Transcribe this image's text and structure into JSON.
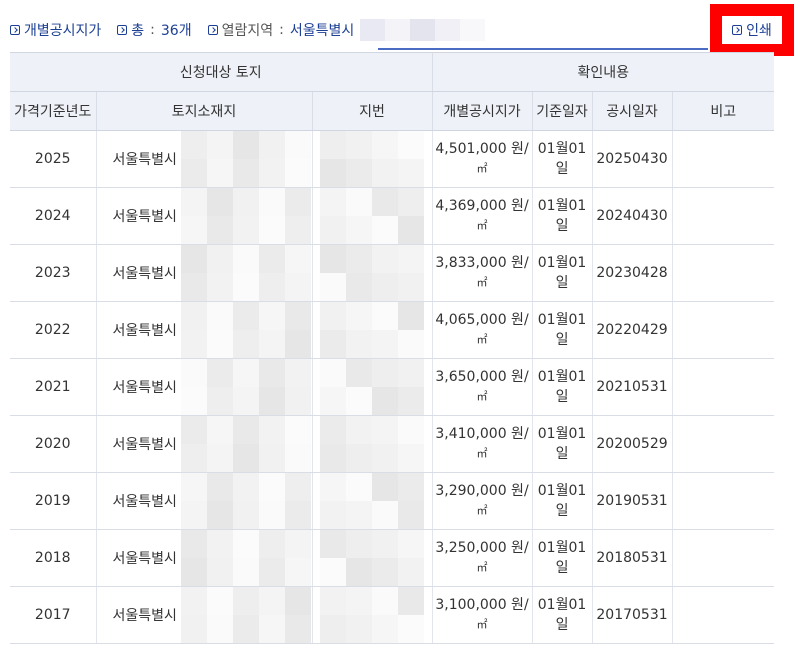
{
  "info": {
    "type_label": "개별공시지가",
    "total_label": "총",
    "total_value": "36개",
    "region_label": "열람지역",
    "region_value": "서울특별시",
    "separator": ":"
  },
  "print": {
    "label": "인쇄"
  },
  "table": {
    "group_headers": {
      "land": "신청대상 토지",
      "confirm": "확인내용"
    },
    "headers": {
      "year": "가격기준년도",
      "address": "토지소재지",
      "jibun": "지번",
      "price": "개별공시지가",
      "base_date": "기준일자",
      "announce_date": "공시일자",
      "note": "비고"
    },
    "rows": [
      {
        "year": "2025",
        "address": "서울특별시",
        "price": "4,501,000 원/",
        "unit": "㎡",
        "base_line1": "01월01",
        "base_line2": "일",
        "announce": "20250430",
        "note": ""
      },
      {
        "year": "2024",
        "address": "서울특별시",
        "price": "4,369,000 원/",
        "unit": "㎡",
        "base_line1": "01월01",
        "base_line2": "일",
        "announce": "20240430",
        "note": ""
      },
      {
        "year": "2023",
        "address": "서울특별시",
        "price": "3,833,000 원/",
        "unit": "㎡",
        "base_line1": "01월01",
        "base_line2": "일",
        "announce": "20230428",
        "note": ""
      },
      {
        "year": "2022",
        "address": "서울특별시",
        "price": "4,065,000 원/",
        "unit": "㎡",
        "base_line1": "01월01",
        "base_line2": "일",
        "announce": "20220429",
        "note": ""
      },
      {
        "year": "2021",
        "address": "서울특별시",
        "price": "3,650,000 원/",
        "unit": "㎡",
        "base_line1": "01월01",
        "base_line2": "일",
        "announce": "20210531",
        "note": ""
      },
      {
        "year": "2020",
        "address": "서울특별시",
        "price": "3,410,000 원/",
        "unit": "㎡",
        "base_line1": "01월01",
        "base_line2": "일",
        "announce": "20200529",
        "note": ""
      },
      {
        "year": "2019",
        "address": "서울특별시",
        "price": "3,290,000 원/",
        "unit": "㎡",
        "base_line1": "01월01",
        "base_line2": "일",
        "announce": "20190531",
        "note": ""
      },
      {
        "year": "2018",
        "address": "서울특별시",
        "price": "3,250,000 원/",
        "unit": "㎡",
        "base_line1": "01월01",
        "base_line2": "일",
        "announce": "20180531",
        "note": ""
      },
      {
        "year": "2017",
        "address": "서울특별시",
        "price": "3,100,000 원/",
        "unit": "㎡",
        "base_line1": "01월01",
        "base_line2": "일",
        "announce": "20170531",
        "note": ""
      }
    ]
  },
  "colors": {
    "accent": "#1c3f94",
    "highlight": "#ff0000",
    "header_bg": "#eef2f8",
    "divider": "#4b6cc4"
  }
}
